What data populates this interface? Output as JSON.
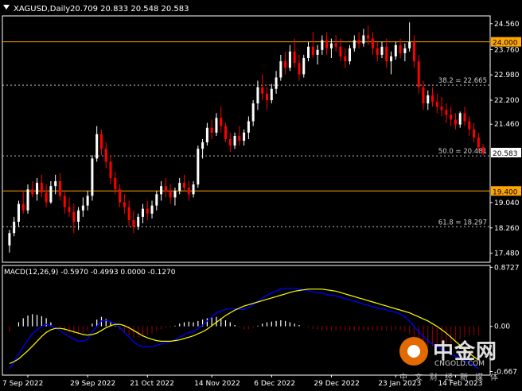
{
  "header": {
    "symbol_label": "XAGUSD,Daily",
    "ohlc": "20.709 20.833 20.548 20.583",
    "macd_label": "MACD(12,26,9) -0.5970 -0.4993 0.0000 -0.1270"
  },
  "watermark": {
    "brand": "中金网",
    "domain": "CNGOLD.COM",
    "slogan": "中文财经新媒体"
  },
  "colors": {
    "background": "#000000",
    "bull": "#ffffff",
    "bear": "#ff0000",
    "level_line": "#ffa500",
    "fib_line": "#c0c0c0",
    "current_price_bg": "#ffffff",
    "macd_signal": "#ffff00",
    "macd_main": "#0000ff"
  },
  "chart_data": [
    {
      "type": "candlestick",
      "title": "XAGUSD,Daily",
      "ylim": [
        17.2,
        24.8
      ],
      "y_ticks": [
        "24.560",
        "23.760",
        "22.980",
        "22.200",
        "21.460",
        "19.040",
        "18.260",
        "17.480"
      ],
      "x_ticks": [
        "7 Sep 2022",
        "29 Sep 2022",
        "21 Oct 2022",
        "14 Nov 2022",
        "6 Dec 2022",
        "29 Dec 2022",
        "23 Jan 2023",
        "14 Feb 2023"
      ],
      "horizontal_levels": [
        {
          "value": 24.0,
          "label": "24.000",
          "style": "solid"
        },
        {
          "value": 19.4,
          "label": "19.400",
          "style": "solid"
        }
      ],
      "fib_levels": [
        {
          "value": 22.665,
          "label": "38.2 = 22.665"
        },
        {
          "value": 20.481,
          "label": "50.0 = 20.481"
        },
        {
          "value": 18.297,
          "label": "61.8 = 18.297"
        }
      ],
      "current_price": {
        "value": 20.583,
        "label": "20.583"
      },
      "ohlc": [
        [
          17.72,
          18.2,
          17.5,
          18.1
        ],
        [
          18.1,
          18.6,
          18.0,
          18.45
        ],
        [
          18.45,
          19.1,
          18.3,
          19.0
        ],
        [
          19.0,
          19.4,
          18.7,
          18.8
        ],
        [
          18.8,
          19.6,
          18.7,
          19.45
        ],
        [
          19.45,
          19.7,
          19.2,
          19.3
        ],
        [
          19.3,
          19.8,
          19.1,
          19.65
        ],
        [
          19.65,
          19.9,
          19.2,
          19.35
        ],
        [
          19.35,
          19.6,
          18.9,
          19.05
        ],
        [
          19.05,
          19.7,
          19.0,
          19.55
        ],
        [
          19.55,
          19.9,
          19.3,
          19.7
        ],
        [
          19.7,
          19.95,
          19.1,
          19.25
        ],
        [
          19.25,
          19.4,
          18.7,
          18.9
        ],
        [
          18.9,
          19.2,
          18.6,
          18.75
        ],
        [
          18.75,
          19.0,
          18.1,
          18.45
        ],
        [
          18.45,
          18.9,
          18.2,
          18.8
        ],
        [
          18.8,
          19.2,
          18.6,
          18.95
        ],
        [
          18.95,
          19.4,
          18.8,
          19.25
        ],
        [
          19.25,
          20.5,
          19.1,
          20.4
        ],
        [
          20.4,
          21.4,
          20.3,
          21.15
        ],
        [
          21.15,
          21.3,
          20.5,
          20.7
        ],
        [
          20.7,
          20.9,
          20.1,
          20.3
        ],
        [
          20.3,
          20.5,
          19.6,
          19.8
        ],
        [
          19.8,
          20.0,
          19.3,
          19.45
        ],
        [
          19.45,
          19.6,
          18.9,
          19.05
        ],
        [
          19.05,
          19.3,
          18.7,
          18.9
        ],
        [
          18.9,
          19.1,
          18.3,
          18.5
        ],
        [
          18.5,
          18.8,
          18.1,
          18.3
        ],
        [
          18.3,
          18.7,
          18.2,
          18.6
        ],
        [
          18.6,
          19.0,
          18.4,
          18.85
        ],
        [
          18.85,
          19.1,
          18.5,
          18.7
        ],
        [
          18.7,
          19.1,
          18.55,
          18.95
        ],
        [
          18.95,
          19.4,
          18.8,
          19.3
        ],
        [
          19.3,
          19.7,
          19.1,
          19.55
        ],
        [
          19.55,
          19.8,
          19.2,
          19.4
        ],
        [
          19.4,
          19.6,
          19.0,
          19.2
        ],
        [
          19.2,
          19.5,
          18.95,
          19.4
        ],
        [
          19.4,
          19.8,
          19.3,
          19.65
        ],
        [
          19.65,
          19.9,
          19.4,
          19.5
        ],
        [
          19.5,
          19.7,
          19.1,
          19.3
        ],
        [
          19.3,
          19.7,
          19.2,
          19.6
        ],
        [
          19.6,
          20.8,
          19.5,
          20.7
        ],
        [
          20.7,
          21.0,
          20.4,
          20.9
        ],
        [
          20.9,
          21.5,
          20.8,
          21.35
        ],
        [
          21.35,
          21.6,
          21.0,
          21.2
        ],
        [
          21.2,
          21.8,
          21.1,
          21.65
        ],
        [
          21.65,
          22.0,
          21.2,
          21.4
        ],
        [
          21.4,
          21.5,
          20.9,
          21.0
        ],
        [
          21.0,
          21.2,
          20.6,
          20.8
        ],
        [
          20.8,
          21.2,
          20.7,
          21.1
        ],
        [
          21.1,
          21.4,
          20.8,
          20.95
        ],
        [
          20.95,
          21.3,
          20.8,
          21.2
        ],
        [
          21.2,
          21.7,
          21.0,
          21.55
        ],
        [
          21.55,
          22.2,
          21.4,
          22.1
        ],
        [
          22.1,
          22.8,
          21.9,
          22.6
        ],
        [
          22.6,
          23.0,
          22.2,
          22.4
        ],
        [
          22.4,
          22.6,
          21.9,
          22.2
        ],
        [
          22.2,
          22.7,
          22.1,
          22.55
        ],
        [
          22.55,
          23.1,
          22.4,
          22.9
        ],
        [
          22.9,
          23.6,
          22.8,
          23.4
        ],
        [
          23.4,
          23.7,
          23.0,
          23.2
        ],
        [
          23.2,
          23.9,
          23.1,
          23.7
        ],
        [
          23.7,
          24.1,
          23.2,
          23.35
        ],
        [
          23.35,
          23.6,
          22.8,
          23.0
        ],
        [
          23.0,
          23.6,
          22.9,
          23.5
        ],
        [
          23.5,
          24.0,
          23.4,
          23.85
        ],
        [
          23.85,
          24.3,
          23.5,
          23.6
        ],
        [
          23.6,
          23.9,
          23.3,
          23.75
        ],
        [
          23.75,
          24.2,
          23.6,
          24.05
        ],
        [
          24.05,
          24.3,
          23.6,
          23.8
        ],
        [
          23.8,
          24.1,
          23.5,
          23.95
        ],
        [
          23.95,
          24.2,
          23.7,
          23.85
        ],
        [
          23.85,
          24.1,
          23.4,
          23.55
        ],
        [
          23.55,
          23.8,
          23.2,
          23.4
        ],
        [
          23.4,
          23.9,
          23.3,
          23.8
        ],
        [
          23.8,
          24.2,
          23.7,
          24.05
        ],
        [
          24.05,
          24.3,
          23.8,
          23.95
        ],
        [
          23.95,
          24.4,
          23.85,
          24.2
        ],
        [
          24.2,
          24.5,
          23.9,
          24.1
        ],
        [
          24.1,
          24.3,
          23.6,
          23.8
        ],
        [
          23.8,
          24.0,
          23.4,
          23.6
        ],
        [
          23.6,
          24.0,
          23.5,
          23.85
        ],
        [
          23.85,
          24.1,
          23.2,
          23.4
        ],
        [
          23.4,
          23.7,
          23.0,
          23.55
        ],
        [
          23.55,
          24.0,
          23.45,
          23.9
        ],
        [
          23.9,
          24.1,
          23.5,
          23.65
        ],
        [
          23.65,
          23.95,
          23.4,
          23.8
        ],
        [
          23.8,
          24.6,
          23.7,
          24.0
        ],
        [
          24.0,
          24.2,
          23.2,
          23.4
        ],
        [
          23.4,
          23.6,
          22.4,
          22.6
        ],
        [
          22.6,
          22.8,
          21.9,
          22.1
        ],
        [
          22.1,
          22.5,
          21.9,
          22.35
        ],
        [
          22.35,
          22.6,
          22.0,
          22.15
        ],
        [
          22.15,
          22.4,
          21.8,
          22.0
        ],
        [
          22.0,
          22.3,
          21.7,
          21.9
        ],
        [
          21.9,
          22.1,
          21.5,
          21.75
        ],
        [
          21.75,
          22.0,
          21.4,
          21.6
        ],
        [
          21.6,
          21.8,
          21.3,
          21.45
        ],
        [
          21.45,
          21.85,
          21.35,
          21.8
        ],
        [
          21.8,
          22.0,
          21.4,
          21.55
        ],
        [
          21.55,
          21.7,
          21.1,
          21.3
        ],
        [
          21.3,
          21.5,
          20.9,
          21.05
        ],
        [
          21.05,
          21.2,
          20.6,
          20.75
        ],
        [
          20.75,
          20.85,
          20.5,
          20.58
        ]
      ]
    },
    {
      "type": "macd",
      "title": "MACD(12,26,9) -0.5970 -0.4993 0.0000 -0.1270",
      "ylim": [
        -0.72,
        0.9
      ],
      "y_ticks": [
        "0.8727",
        "0.00",
        "-0.667"
      ],
      "histogram": [
        -0.08,
        0.0,
        0.06,
        0.12,
        0.16,
        0.18,
        0.17,
        0.15,
        0.12,
        0.06,
        0.0,
        -0.03,
        -0.07,
        -0.09,
        -0.11,
        -0.12,
        -0.1,
        -0.06,
        0.04,
        0.1,
        0.14,
        0.11,
        0.06,
        0.01,
        -0.05,
        -0.1,
        -0.14,
        -0.17,
        -0.18,
        -0.16,
        -0.13,
        -0.11,
        -0.07,
        -0.04,
        -0.02,
        -0.01,
        0.01,
        0.04,
        0.06,
        0.07,
        0.06,
        0.08,
        0.1,
        0.12,
        0.13,
        0.14,
        0.12,
        0.09,
        0.06,
        0.02,
        -0.02,
        -0.05,
        -0.04,
        -0.02,
        0.01,
        0.04,
        0.06,
        0.07,
        0.08,
        0.09,
        0.08,
        0.06,
        0.04,
        0.02,
        0.0,
        -0.02,
        -0.04,
        -0.05,
        -0.06,
        -0.07,
        -0.07,
        -0.07,
        -0.07,
        -0.07,
        -0.07,
        -0.07,
        -0.07,
        -0.07,
        -0.07,
        -0.07,
        -0.07,
        -0.06,
        -0.06,
        -0.06,
        -0.05,
        -0.06,
        -0.08,
        -0.12,
        -0.17,
        -0.22,
        -0.26,
        -0.29,
        -0.3,
        -0.3,
        -0.29,
        -0.27,
        -0.25,
        -0.22,
        -0.19,
        -0.16,
        -0.14,
        -0.13,
        -0.13
      ],
      "signal": [
        -0.55,
        -0.52,
        -0.48,
        -0.42,
        -0.36,
        -0.29,
        -0.22,
        -0.15,
        -0.09,
        -0.05,
        -0.03,
        -0.03,
        -0.04,
        -0.06,
        -0.08,
        -0.1,
        -0.12,
        -0.13,
        -0.12,
        -0.1,
        -0.06,
        -0.02,
        0.01,
        0.03,
        0.03,
        0.01,
        -0.02,
        -0.06,
        -0.1,
        -0.14,
        -0.17,
        -0.19,
        -0.21,
        -0.22,
        -0.22,
        -0.22,
        -0.21,
        -0.2,
        -0.18,
        -0.16,
        -0.14,
        -0.11,
        -0.08,
        -0.04,
        0.01,
        0.06,
        0.11,
        0.16,
        0.2,
        0.24,
        0.27,
        0.3,
        0.32,
        0.34,
        0.36,
        0.38,
        0.4,
        0.42,
        0.44,
        0.46,
        0.48,
        0.5,
        0.52,
        0.53,
        0.54,
        0.55,
        0.55,
        0.55,
        0.55,
        0.54,
        0.53,
        0.52,
        0.5,
        0.48,
        0.46,
        0.44,
        0.42,
        0.4,
        0.38,
        0.36,
        0.34,
        0.32,
        0.3,
        0.28,
        0.26,
        0.24,
        0.22,
        0.2,
        0.17,
        0.14,
        0.11,
        0.08,
        0.04,
        0.0,
        -0.05,
        -0.1,
        -0.16,
        -0.22,
        -0.28,
        -0.34,
        -0.4,
        -0.45,
        -0.5
      ],
      "macd": [
        -0.63,
        -0.52,
        -0.42,
        -0.3,
        -0.2,
        -0.11,
        -0.05,
        0.0,
        0.03,
        0.01,
        -0.03,
        -0.06,
        -0.11,
        -0.15,
        -0.19,
        -0.22,
        -0.22,
        -0.19,
        -0.08,
        0.0,
        0.08,
        0.09,
        0.07,
        0.04,
        -0.02,
        -0.09,
        -0.16,
        -0.23,
        -0.28,
        -0.3,
        -0.3,
        -0.3,
        -0.28,
        -0.26,
        -0.24,
        -0.23,
        -0.2,
        -0.16,
        -0.12,
        -0.09,
        -0.08,
        -0.03,
        0.02,
        0.08,
        0.14,
        0.2,
        0.23,
        0.25,
        0.26,
        0.26,
        0.25,
        0.25,
        0.28,
        0.32,
        0.37,
        0.42,
        0.46,
        0.49,
        0.52,
        0.55,
        0.56,
        0.56,
        0.56,
        0.55,
        0.54,
        0.53,
        0.51,
        0.5,
        0.49,
        0.47,
        0.46,
        0.45,
        0.43,
        0.41,
        0.39,
        0.37,
        0.35,
        0.33,
        0.31,
        0.29,
        0.27,
        0.26,
        0.24,
        0.22,
        0.21,
        0.18,
        0.14,
        0.08,
        0.0,
        -0.08,
        -0.15,
        -0.21,
        -0.26,
        -0.3,
        -0.34,
        -0.37,
        -0.41,
        -0.44,
        -0.47,
        -0.5,
        -0.54,
        -0.58,
        -0.63
      ]
    }
  ]
}
